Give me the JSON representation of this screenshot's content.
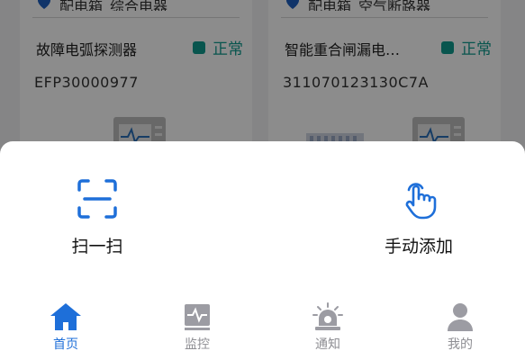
{
  "cards": [
    {
      "location": "配电箱_综合电器",
      "name": "故障电弧探测器",
      "status": "正常",
      "code": "EFP30000977"
    },
    {
      "location": "配电箱_空气断路器",
      "name": "智能重合闸漏电…",
      "status": "正常",
      "code": "311070123130C7A"
    }
  ],
  "sheet": {
    "actions": [
      {
        "label": "扫一扫",
        "icon": "scan-icon"
      },
      {
        "label": "手动添加",
        "icon": "tap-hand-icon"
      }
    ]
  },
  "tabbar": {
    "items": [
      {
        "label": "首页",
        "icon": "home-icon",
        "active": true
      },
      {
        "label": "监控",
        "icon": "monitor-icon",
        "active": false
      },
      {
        "label": "通知",
        "icon": "alarm-light-icon",
        "active": false
      },
      {
        "label": "我的",
        "icon": "user-icon",
        "active": false
      }
    ]
  },
  "colors": {
    "accent": "#1e6fd9",
    "status": "#0f9b8e",
    "inactive": "#8e8e93"
  }
}
